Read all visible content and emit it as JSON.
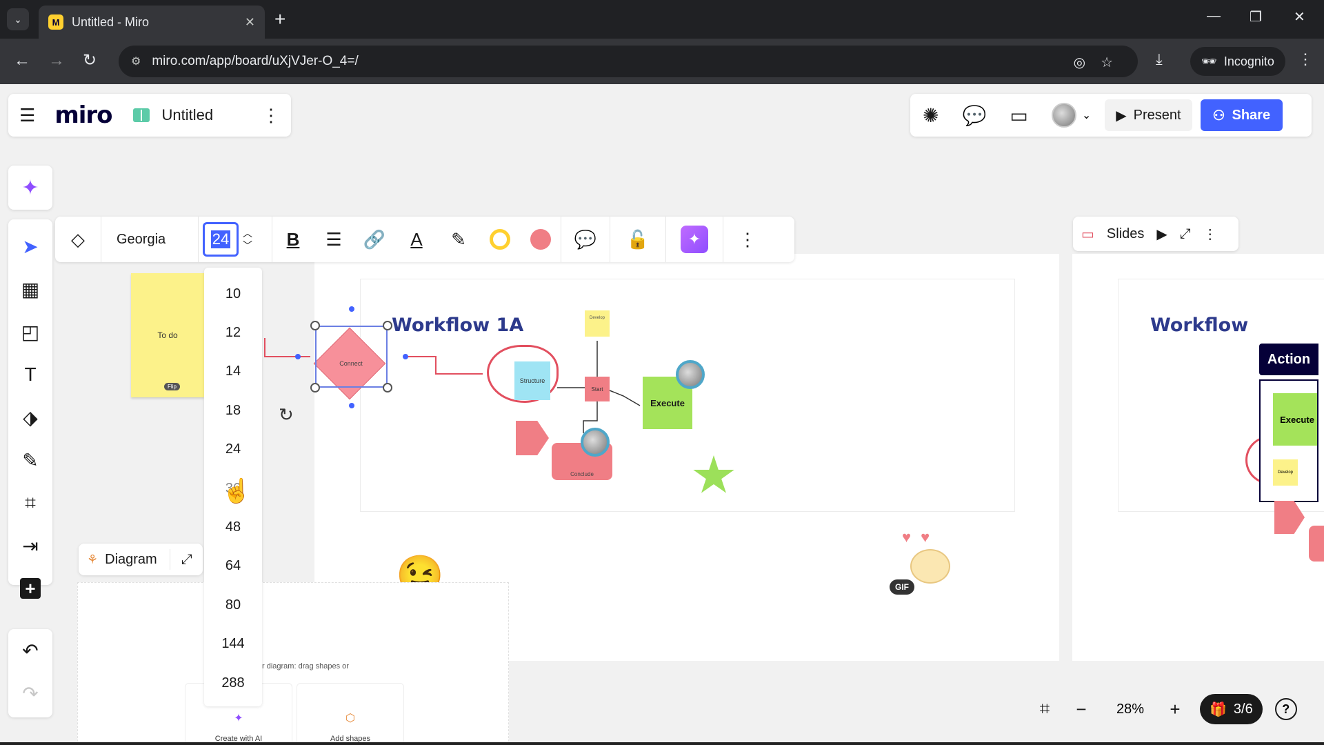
{
  "browser": {
    "tab_title": "Untitled - Miro",
    "favicon_letter": "M",
    "url": "miro.com/app/board/uXjVJer-O_4=/",
    "incognito_label": "Incognito"
  },
  "header": {
    "logo": "miro",
    "board_name": "Untitled",
    "present_label": "Present",
    "share_label": "Share"
  },
  "left_toolbar": {
    "tools": [
      "select-icon",
      "templates-icon",
      "sticky-note-icon",
      "text-icon",
      "shapes-icon",
      "pen-icon",
      "frame-icon",
      "upload-icon",
      "add-icon"
    ]
  },
  "text_toolbar": {
    "font_family": "Georgia",
    "font_size": "24",
    "text_color": "#1a1a1a",
    "border_color": "#ffd02f",
    "fill_color": "#f07e85"
  },
  "font_size_options": [
    "10",
    "12",
    "14",
    "18",
    "24",
    "36",
    "48",
    "64",
    "80",
    "144",
    "288"
  ],
  "board": {
    "todo_sticky": "To do",
    "flip_badge": "Flip",
    "workflow_title": "Workflow 1A",
    "workflow_title_right": "Workflow",
    "diamond_label": "Connect",
    "structure_label": "Structure",
    "small_sticky_label": "Develop",
    "start_label": "Start",
    "execute_label": "Execute",
    "conclude_label": "Conclude",
    "gif_badge": "GIF",
    "emoji": "😉"
  },
  "slides": {
    "label": "Slides"
  },
  "right_thumb": {
    "action_label": "Action",
    "execute_label": "Execute",
    "sticky_label": "Develop"
  },
  "diagram": {
    "chip_label": "Diagram",
    "hint_text": "r diagram: drag shapes or",
    "create_ai_label": "Create with AI",
    "add_shapes_label": "Add shapes"
  },
  "zoom": {
    "level": "28%",
    "pages": "3/6"
  },
  "colors": {
    "accent": "#4262ff",
    "brand_dark": "#050038",
    "sticky_yellow": "#fcf28a",
    "pink": "#f07e85",
    "green": "#a4e35a",
    "ai_purple": "#8f4dff"
  }
}
